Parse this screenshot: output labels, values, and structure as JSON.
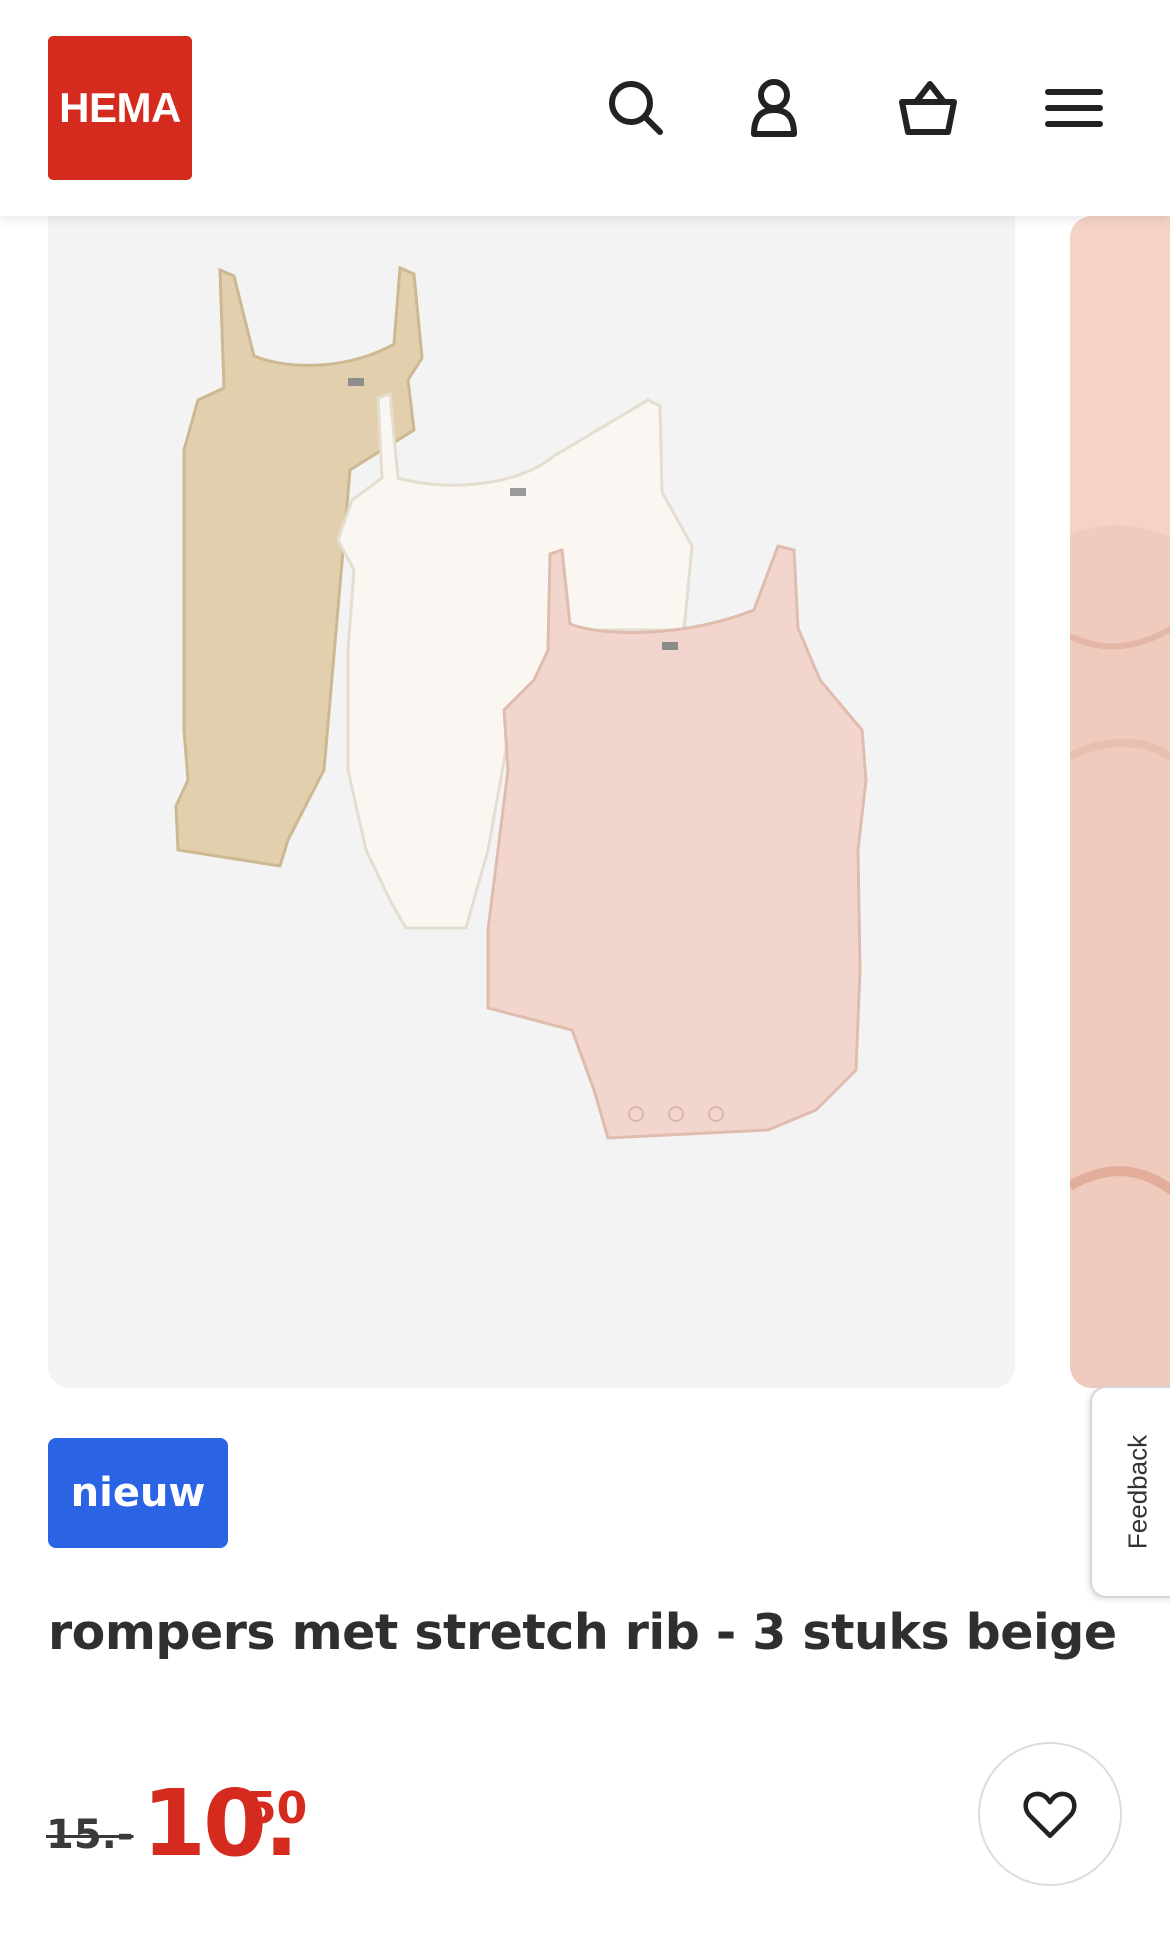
{
  "header": {
    "logo_text": "HEMA",
    "logo_color": "#d52b1e",
    "icons": [
      "search-icon",
      "account-icon",
      "basket-icon",
      "menu-icon"
    ]
  },
  "gallery": {
    "image_subject": "product-photo-rompers",
    "colors": [
      "#e1cfae",
      "#faf7f2",
      "#f2d6cd"
    ]
  },
  "feedback": {
    "label": "Feedback"
  },
  "product": {
    "badge": "nieuw",
    "badge_color": "#2a63e4",
    "title": "rompers met stretch rib - 3 stuks beige",
    "old_price": "15.-",
    "price_main": "10.",
    "price_cents": "50",
    "price_color": "#d52b1e"
  }
}
